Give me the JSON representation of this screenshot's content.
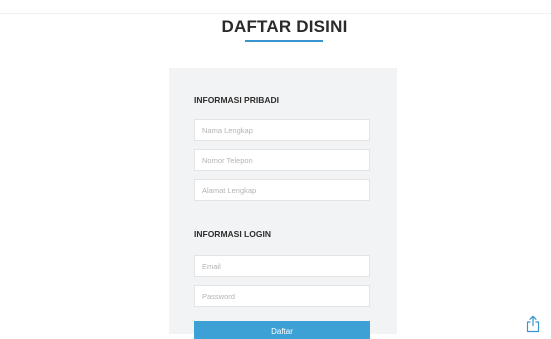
{
  "page": {
    "title": "DAFTAR DISINI"
  },
  "form": {
    "personal_section": {
      "heading": "INFORMASI PRIBADI",
      "fields": {
        "full_name": {
          "value": "",
          "placeholder": "Nama Lengkap"
        },
        "phone": {
          "value": "",
          "placeholder": "Nomor Telepon"
        },
        "address": {
          "value": "",
          "placeholder": "Alamat Lengkap"
        }
      }
    },
    "login_section": {
      "heading": "INFORMASI LOGIN",
      "fields": {
        "email": {
          "value": "",
          "placeholder": "Email"
        },
        "password": {
          "value": "",
          "placeholder": "Password"
        }
      }
    },
    "submit_label": "Daftar"
  },
  "icons": {
    "share": "share-icon"
  },
  "colors": {
    "accent": "#3a95cf",
    "button": "#3ea1d6",
    "card_background": "#f2f3f4",
    "title_text": "#2b2b2b"
  }
}
